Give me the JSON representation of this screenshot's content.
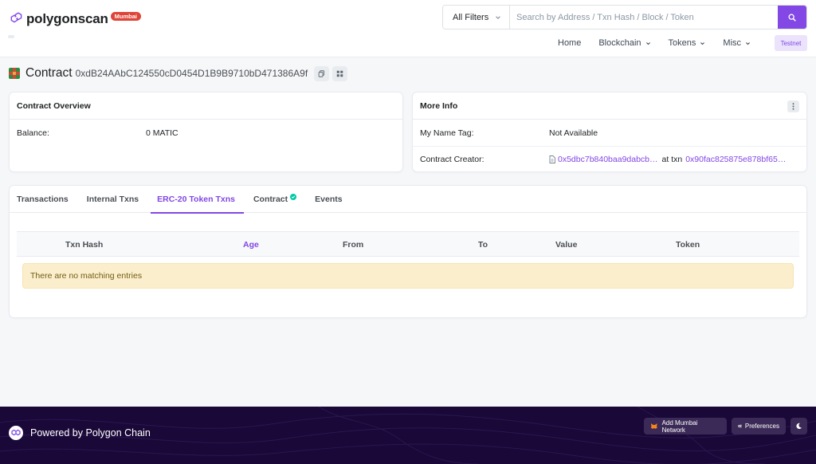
{
  "header": {
    "logo_text": "polygonscan",
    "network_badge": "Mumbai",
    "filter_label": "All Filters",
    "search_placeholder": "Search by Address / Txn Hash / Block / Token",
    "nav": [
      {
        "label": "Home"
      },
      {
        "label": "Blockchain"
      },
      {
        "label": "Tokens"
      },
      {
        "label": "Misc"
      }
    ],
    "testnet_label": "Testnet"
  },
  "title": {
    "label": "Contract",
    "address": "0xdB24AAbC124550cD0454D1B9B9710bD471386A9f"
  },
  "overview": {
    "heading": "Contract Overview",
    "balance_label": "Balance:",
    "balance_value": "0 MATIC"
  },
  "more_info": {
    "heading": "More Info",
    "name_tag_label": "My Name Tag:",
    "name_tag_value": "Not Available",
    "creator_label": "Contract Creator:",
    "creator_address": "0x5dbc7b840baa9dabcb…",
    "at_txn_label": "at txn",
    "creator_txn": "0x90fac825875e878bf65…"
  },
  "tabs": [
    {
      "label": "Transactions"
    },
    {
      "label": "Internal Txns"
    },
    {
      "label": "ERC-20 Token Txns"
    },
    {
      "label": "Contract"
    },
    {
      "label": "Events"
    }
  ],
  "table": {
    "columns": [
      "Txn Hash",
      "Age",
      "From",
      "To",
      "Value",
      "Token"
    ],
    "empty_message": "There are no matching entries"
  },
  "footer": {
    "powered_by": "Powered by Polygon Chain",
    "add_network_label": "Add Mumbai Network",
    "preferences_label": "Preferences"
  },
  "colors": {
    "accent": "#8247e5",
    "badge": "#de4437",
    "footer_bg": "#1a0838",
    "verified": "#00c9a7",
    "empty_bg": "#fbeecc"
  }
}
